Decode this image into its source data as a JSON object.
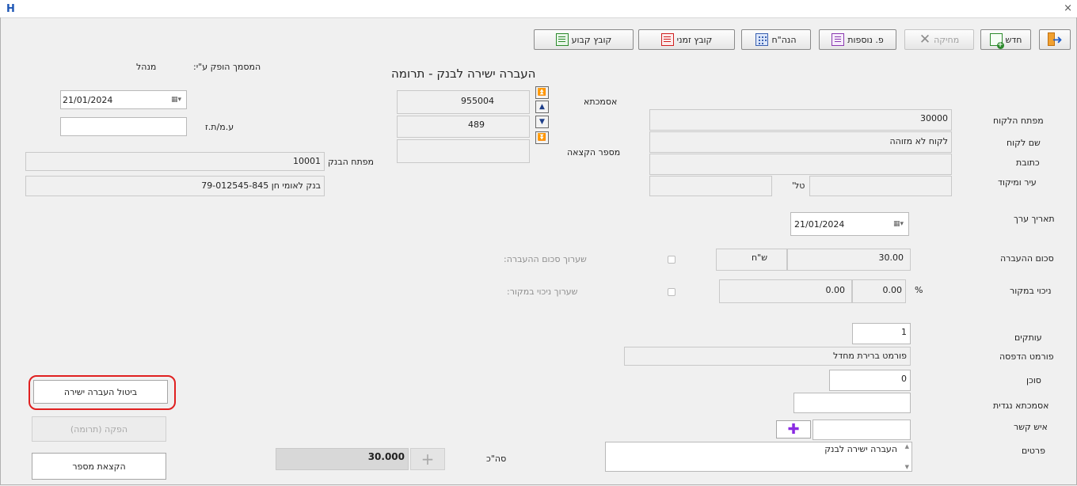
{
  "window": {
    "logo_letter": "H",
    "close": "×"
  },
  "toolbar": {
    "fixed_file": "קובץ קבוע",
    "temp_file": "קובץ זמני",
    "journal": "הנה\"ח",
    "more_details": "פ. נוספות",
    "delete": "מחיקה",
    "new": "חדש"
  },
  "header": {
    "title": "העברה ישירה לבנק - תרומה",
    "issued_by_label": "המסמך הופק ע\"י:",
    "issued_by_value": "מנהל"
  },
  "left_panel": {
    "date": "21/01/2024",
    "id_label": "ע.מ/ת.ז",
    "id_value": "",
    "bank_key_label": "מפתח הבנק",
    "bank_key_value": "10001",
    "bank_account_value": "בנק לאומי חן 79-012545-845"
  },
  "middle_panel": {
    "voucher_label": "אסמכתא",
    "voucher_value": "955004",
    "second_value": "489",
    "allocation_number_label": "מספר הקצאה",
    "allocation_number_value": ""
  },
  "customer": {
    "key_label": "מפתח הלקוח",
    "key_value": "30000",
    "name_label": "שם לקוח",
    "name_value": "לקוח לא מזוהה",
    "address_label": "כתובת",
    "address_value": "",
    "city_label": "עיר ומיקוד",
    "city_value": "",
    "phone_label": "טל'",
    "phone_value": ""
  },
  "transfer": {
    "value_date_label": "תאריך ערך",
    "value_date": "21/01/2024",
    "amount_label": "סכום ההעברה",
    "amount_value": "30.00",
    "currency": "ש\"ח",
    "amount_value_label": "שערוך סכום ההעברה:",
    "withholding_label": "ניכוי במקור",
    "withholding_amount": "0.00",
    "withholding_percent": "0.00",
    "percent_sign": "%",
    "withholding_value_label": "שערוך ניכוי במקור:"
  },
  "extra": {
    "copies_label": "עותקים",
    "copies_value": "1",
    "print_format_label": "פורמט הדפסה",
    "print_format_value": "פורמט ברירת מחדל",
    "agent_label": "סוכן",
    "agent_value": "0",
    "counter_voucher_label": "אסמכתא נגדית",
    "counter_voucher_value": "",
    "contact_label": "איש קשר",
    "contact_value": "",
    "details_label": "פרטים",
    "details_value": "העברה ישירה לבנק"
  },
  "bottom_left": {
    "cancel_transfer": "ביטול העברה ישירה",
    "issue_donation": "הפקה (תרומה)",
    "allocate_number": "הקצאת מספר"
  },
  "total": {
    "label": "סה\"כ",
    "value": "30.000",
    "plus": "+"
  }
}
